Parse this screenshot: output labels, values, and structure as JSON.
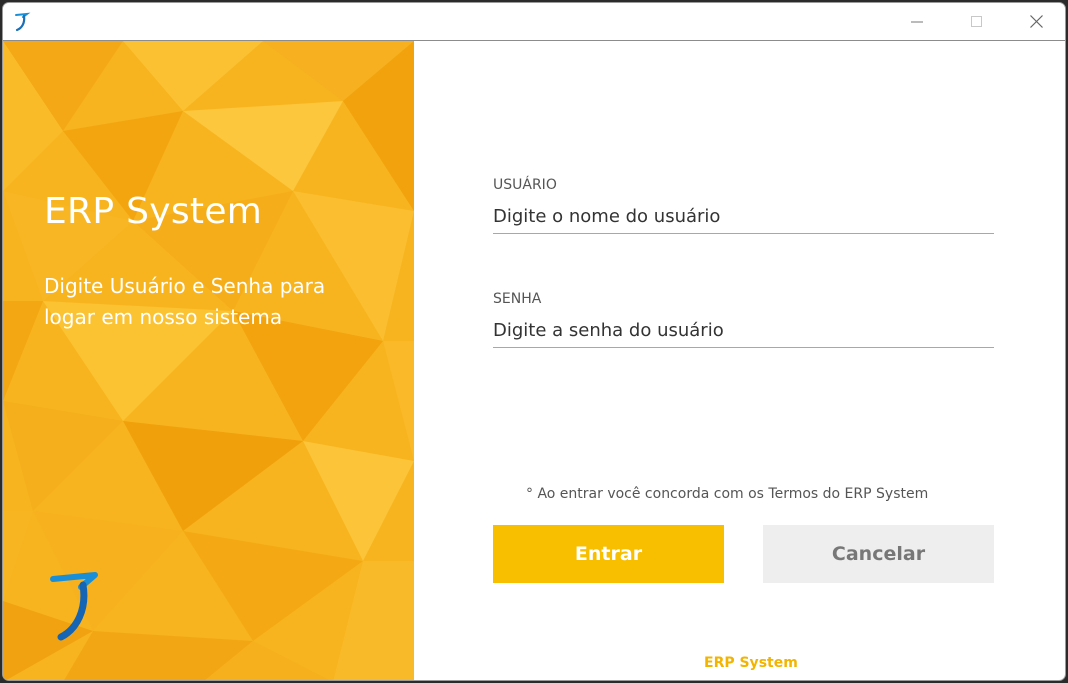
{
  "window": {
    "controls": {
      "minimize_icon": "minimize-icon",
      "maximize_icon": "maximize-icon",
      "close_icon": "close-icon"
    }
  },
  "branding": {
    "title": "ERP System",
    "subtitle": "Digite Usuário e Senha para logar em nosso sistema",
    "logo_icon": "app-logo-icon"
  },
  "form": {
    "user_label": "USUÁRIO",
    "user_placeholder": "Digite o nome do usuário",
    "password_label": "SENHA",
    "password_placeholder": "Digite a senha do usuário",
    "terms_text": "° Ao entrar você concorda com os Termos do ERP System",
    "submit_label": "Entrar",
    "cancel_label": "Cancelar"
  },
  "footer": {
    "text": "ERP System"
  },
  "colors": {
    "accent": "#f8bf00",
    "panel_bg": "#f6ad14",
    "logo_blue": "#1a8fd8",
    "cancel_bg": "#eeeeee"
  }
}
